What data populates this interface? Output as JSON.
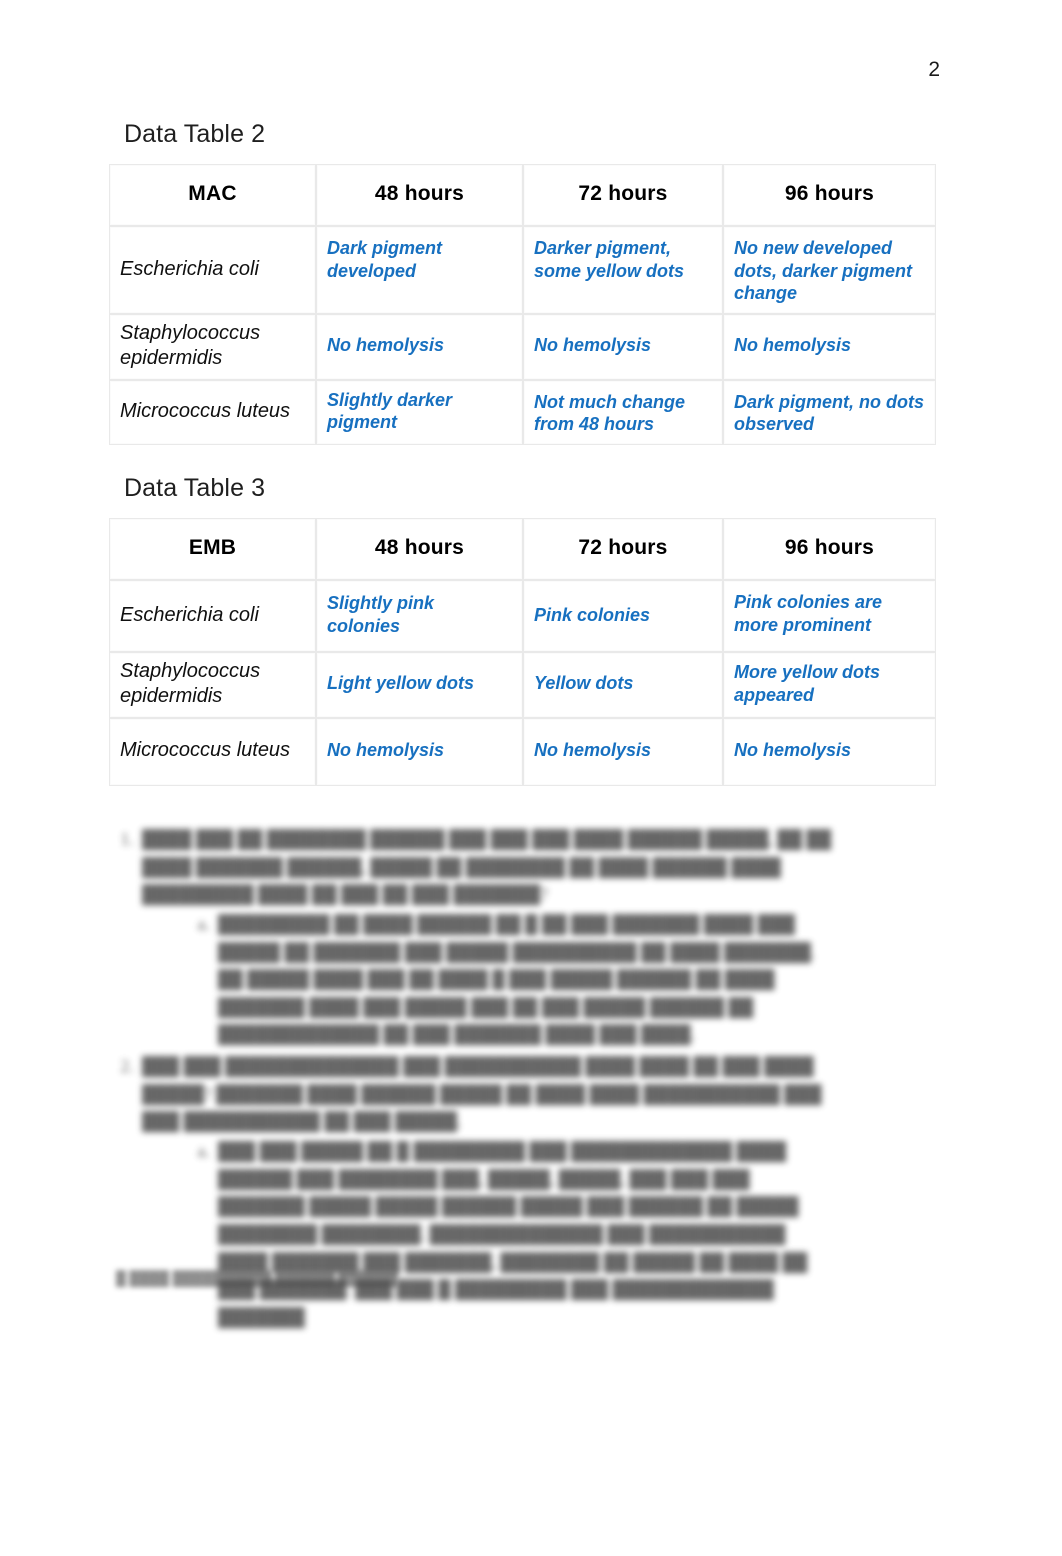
{
  "page": {
    "number": "2"
  },
  "tables": [
    {
      "heading": "Data Table 2",
      "columns": [
        "MAC",
        "48 hours",
        "72 hours",
        "96 hours"
      ],
      "rows": [
        {
          "species": "Escherichia coli",
          "h48": "Dark pigment developed",
          "h72": "Darker pigment, some yellow dots",
          "h96": "No new developed dots, darker pigment change"
        },
        {
          "species": "Staphylococcus epidermidis",
          "h48": "No hemolysis",
          "h72": "No hemolysis",
          "h96": "No hemolysis"
        },
        {
          "species": "Micrococcus luteus",
          "h48": "Slightly darker pigment",
          "h72": "Not much change from 48 hours",
          "h96": "Dark pigment, no dots observed"
        }
      ]
    },
    {
      "heading": "Data Table 3",
      "columns": [
        "EMB",
        "48 hours",
        "72 hours",
        "96 hours"
      ],
      "rows": [
        {
          "species": "Escherichia coli",
          "h48": "Slightly pink colonies",
          "h72": "Pink colonies",
          "h96": "Pink colonies are more prominent"
        },
        {
          "species": "Staphylococcus epidermidis",
          "h48": "Light yellow dots",
          "h72": "Yellow dots",
          "h96": "More yellow dots appeared"
        },
        {
          "species": "Micrococcus luteus",
          "h48": "No hemolysis",
          "h72": "No hemolysis",
          "h96": "No hemolysis"
        }
      ]
    }
  ],
  "redacted": {
    "note": "illegible blurred body text",
    "q1": "████ ███ ██ ████████ ██████ ███ ███ ███ ████ ██████ █████, ██ ██ ████ ███████ ██████, █████ ██ ████████ ██ ████ ██████ ████ █████████ ████ ██ ███ ██ ███ ███████?",
    "a1": "█████████ ██ ████ ██████ ██ █ ██ ███ ███████ ████ ███ █████ ██ ███████ ███ █████ ██████████ ██ ████ ███████. ██ █████ ████ ███ ██ ████ █ ███ █████ ██████ ██ ████ ███████ ████ ███ █████ ███ ██ ███ █████ ██████ ██ █████████████ ██ ███ ███████ ████ ███ ████.",
    "q2": "███ ███ ██████████████ ███ ███████████ ████ ████ ██ ███ ████ █████? ███████ ████ ██████ █████ ██ ████ ████ ███████████ ███ ███ ███████████ ██ ███ █████.",
    "a2": "███ ███ █████ ██ █ █████████ ███ █████████████ ████ ██████ ███ ████████ ███, █████, █████, ███ ███ ███ ███████ █████ █████ ██████ █████ ███ ██████ ██ █████ ████████ ████████. ██████████████ ███ ███████████ ████ ███████ ███ ███████, ████████ ██ █████ ██ ████ ██ ███ ███████. ███ ███ █ █████████ ███ █████████████ ███████",
    "footer": "█ ████ ██████████ ██████ ██████"
  }
}
